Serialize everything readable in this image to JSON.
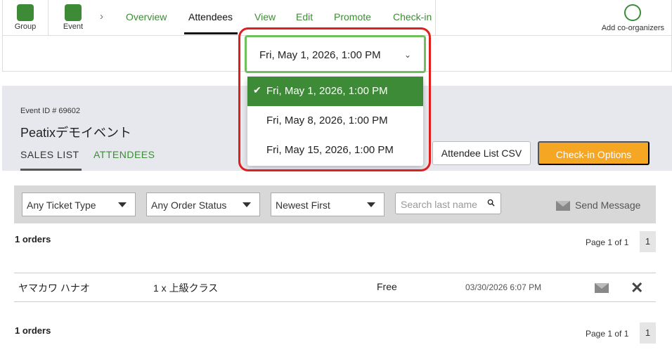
{
  "nav": {
    "group_label": "Group",
    "event_label": "Event",
    "tabs": [
      "Overview",
      "Attendees",
      "View",
      "Edit",
      "Promote",
      "Check-in"
    ],
    "add_coorganizers": "Add co-organizers"
  },
  "date_selector": {
    "value": "Fri, May 1, 2026, 1:00 PM",
    "options": [
      "Fri, May 1, 2026, 1:00 PM",
      "Fri, May 8, 2026, 1:00 PM",
      "Fri, May 15, 2026, 1:00 PM"
    ]
  },
  "event": {
    "id": "Event ID # 69602",
    "name": "Peatixデモイベント",
    "subtabs": [
      "SALES LIST",
      "ATTENDEES"
    ]
  },
  "buttons": {
    "csv": "Attendee List CSV",
    "checkin": "Check-in Options"
  },
  "filters": {
    "ticket_type": "Any Ticket Type",
    "order_status": "Any Order Status",
    "sort": "Newest First",
    "search_placeholder": "Search last name",
    "send_message": "Send Message"
  },
  "summary": {
    "orders": "1 orders",
    "page": "Page 1 of 1",
    "page_num": "1"
  },
  "order_row": {
    "name": "ヤマカワ ハナオ",
    "ticket": "1 x 上級クラス",
    "price": "Free",
    "date": "03/30/2026 6:07 PM"
  },
  "colors": {
    "brand_green": "#3d8b37",
    "accent_orange": "#f5a623",
    "highlight_red": "#e01e1e"
  }
}
